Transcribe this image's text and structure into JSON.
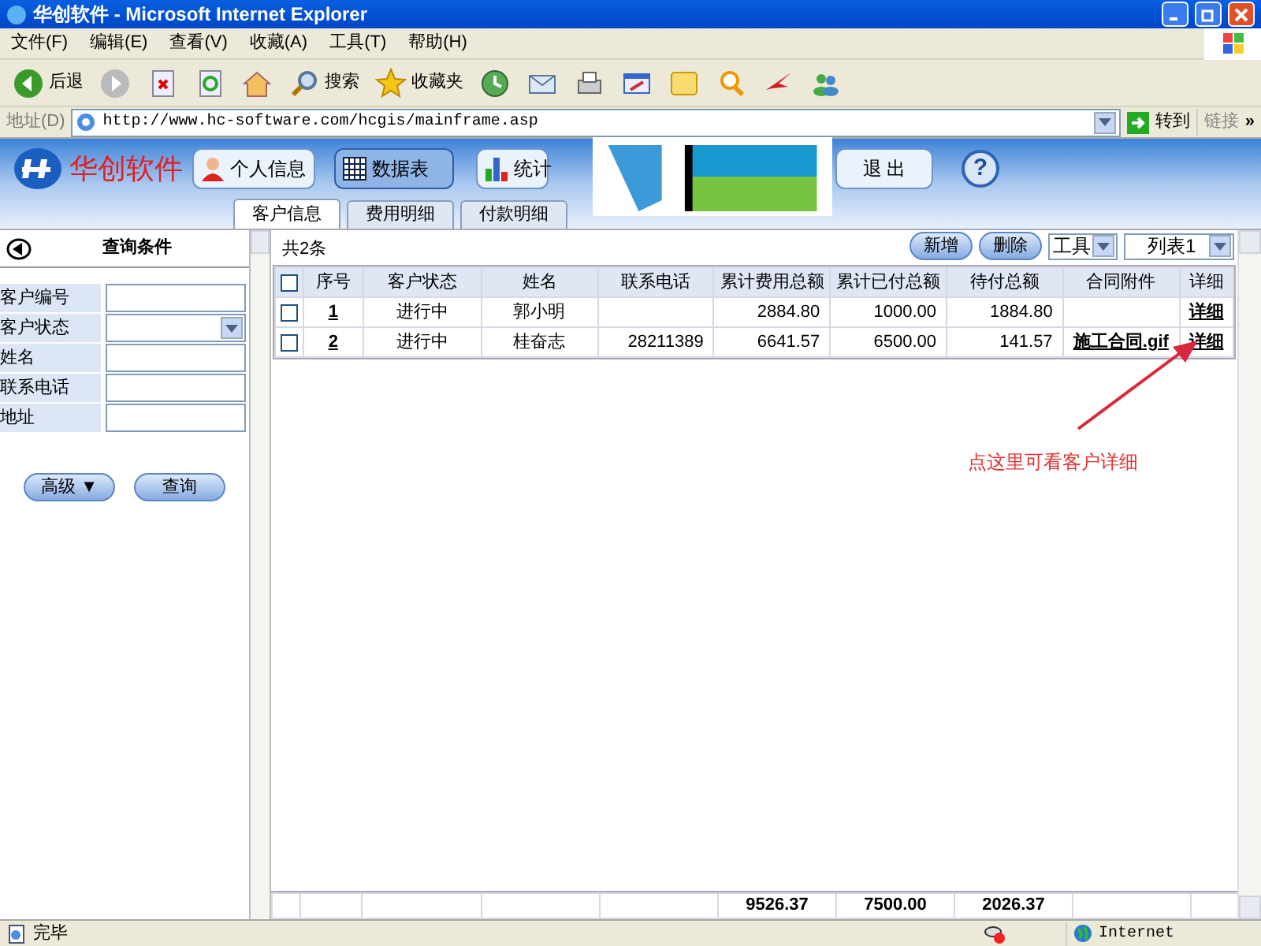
{
  "window": {
    "title": "华创软件 - Microsoft Internet Explorer"
  },
  "menu": [
    "文件(F)",
    "编辑(E)",
    "查看(V)",
    "收藏(A)",
    "工具(T)",
    "帮助(H)"
  ],
  "toolbar": [
    {
      "kind": "back",
      "label": "后退"
    },
    {
      "kind": "forward"
    },
    {
      "kind": "stop"
    },
    {
      "kind": "refresh"
    },
    {
      "kind": "home"
    },
    {
      "kind": "search",
      "label": "搜索"
    },
    {
      "kind": "favorites",
      "label": "收藏夹"
    },
    {
      "kind": "history"
    },
    {
      "kind": "mail"
    },
    {
      "kind": "print"
    },
    {
      "kind": "edit"
    },
    {
      "kind": "note"
    },
    {
      "kind": "research"
    },
    {
      "kind": "bird"
    },
    {
      "kind": "messenger"
    }
  ],
  "address": {
    "label": "地址(D)",
    "url": "http://www.hc-software.com/hcgis/mainframe.asp",
    "go": "转到",
    "links": "链接",
    "more": "»"
  },
  "app": {
    "logo": "华创软件",
    "nav": [
      {
        "label": "个人信息",
        "selected": false
      },
      {
        "label": "数据表",
        "selected": true
      },
      {
        "label": "统计",
        "selected": false
      },
      {
        "label": "退 出",
        "selected": false
      }
    ],
    "help": "?"
  },
  "tabs": [
    {
      "label": "客户信息",
      "selected": true
    },
    {
      "label": "费用明细",
      "selected": false
    },
    {
      "label": "付款明细",
      "selected": false
    }
  ],
  "sidebar": {
    "title": "查询条件",
    "fields": [
      {
        "label": "客户编号",
        "kind": "text"
      },
      {
        "label": "客户状态",
        "kind": "select"
      },
      {
        "label": "姓名",
        "kind": "text"
      },
      {
        "label": "联系电话",
        "kind": "text"
      },
      {
        "label": "地址",
        "kind": "text"
      }
    ],
    "buttons": [
      "高级 ▼",
      "查询"
    ]
  },
  "table": {
    "count": "共2条",
    "actions": [
      "新增",
      "删除"
    ],
    "tool_select": "工具",
    "list_select": "列表1",
    "select_all": {
      "checked": false
    },
    "columns": [
      {
        "label": "序号"
      },
      {
        "label": "客户状态"
      },
      {
        "label": "姓名"
      },
      {
        "label": "联系电话"
      },
      {
        "label": "累计费用总额",
        "total": "9526.37"
      },
      {
        "label": "累计已付总额",
        "total": "7500.00"
      },
      {
        "label": "待付总额",
        "total": "2026.37"
      },
      {
        "label": "合同附件"
      },
      {
        "label": "详细"
      }
    ],
    "rows": [
      {
        "checked": false,
        "cells": [
          "1",
          "进行中",
          "郭小明",
          null,
          "2884.80",
          "1000.00",
          "1884.80",
          null,
          "详细"
        ]
      },
      {
        "checked": false,
        "cells": [
          "2",
          "进行中",
          "桂奋志",
          "28211389",
          "6641.57",
          "6500.00",
          "141.57",
          "施工合同.gif",
          "详细"
        ]
      }
    ]
  },
  "annotation": "点这里可看客户详细",
  "status_bar": {
    "text": "完毕",
    "zone": "Internet"
  }
}
